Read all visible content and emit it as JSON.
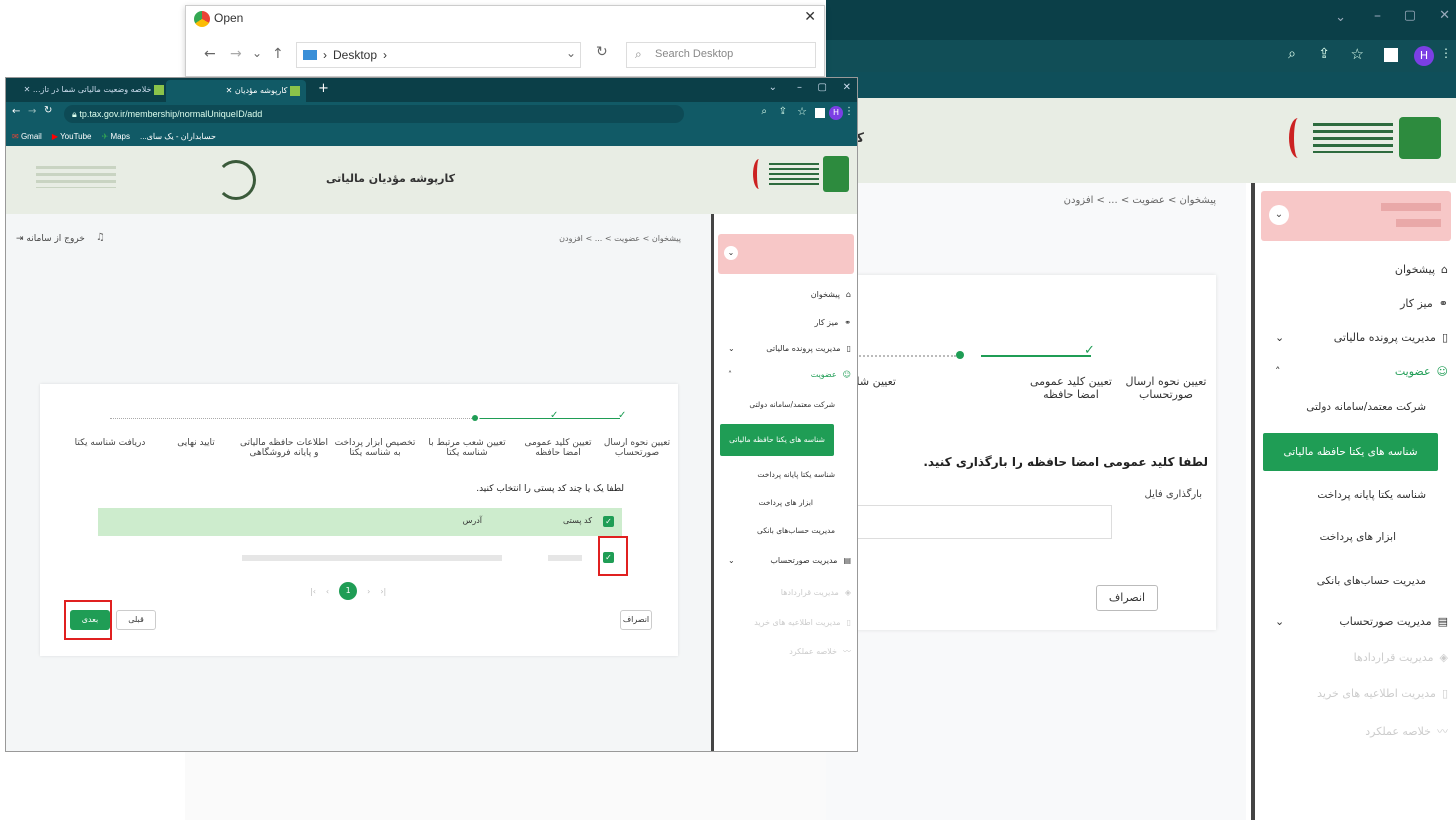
{
  "dialog": {
    "title": "Open",
    "path": "Desktop",
    "search_placeholder": "Search Desktop",
    "close": "✕"
  },
  "small_browser": {
    "tabs": [
      {
        "label": "خلاصه وضعیت مالیاتی شما در تاز..."
      },
      {
        "label": "کارپوشه مؤدیان"
      }
    ],
    "url": "tp.tax.gov.ir/membership/normalUniqueID/add",
    "bookmarks": [
      "Gmail",
      "YouTube",
      "Maps",
      "حسابداران - یک سای..."
    ],
    "header_title": "کارپوشه مؤدیان مالیاتی",
    "logout": "خروج از سامانه",
    "breadcrumb": "پیشخوان > عضویت > ... > افزودن",
    "steps": [
      "تعیین نحوه ارسال صورتحساب",
      "تعیین کلید عمومی امضا حافظه",
      "تعیین شعب مرتبط با شناسه یکتا",
      "تخصیص ابزار پرداخت به شناسه یکتا",
      "اطلاعات حافظه مالیاتی و پایانه فروشگاهی",
      "تایید نهایی",
      "دریافت شناسه یکتا"
    ],
    "instruction": "لطفا یک یا چند کد پستی را انتخاب کنید.",
    "table_headers": {
      "code": "کد پستی",
      "address": "آدرس"
    },
    "pagination": {
      "current": "1"
    },
    "buttons": {
      "next": "بعدی",
      "prev": "قبلی",
      "cancel": "انصراف"
    },
    "sidebar": {
      "items": [
        {
          "label": "پیشخوان"
        },
        {
          "label": "میز کار"
        },
        {
          "label": "مدیریت پرونده مالیاتی"
        },
        {
          "label": "عضویت"
        },
        {
          "label": "شرکت معتمد/سامانه دولتی"
        },
        {
          "label": "شناسه های یکتا حافظه مالیاتی"
        },
        {
          "label": "شناسه یکتا پایانه پرداخت"
        },
        {
          "label": "ابزار های پرداخت"
        },
        {
          "label": "مدیریت حساب‌های بانکی"
        },
        {
          "label": "مدیریت صورتحساب"
        },
        {
          "label": "مدیریت قراردادها"
        },
        {
          "label": "مدیریت اطلاعیه های خرید"
        },
        {
          "label": "خلاصه عملکرد"
        }
      ]
    }
  },
  "big_browser": {
    "breadcrumb": "پیشخوان > عضویت > ... > افزودن",
    "header_title_partial": "کار",
    "steps": [
      "تعیین نحوه ارسال صورتحساب",
      "تعیین کلید عمومی امضا حافظه",
      "تعیین شا"
    ],
    "instruction": "لطفا کلید عمومی امضا حافظه را بارگذاری کنید.",
    "upload_label": "بارگذاری فایل",
    "cancel": "انصراف",
    "sidebar": {
      "items": [
        {
          "label": "پیشخوان"
        },
        {
          "label": "میز کار"
        },
        {
          "label": "مدیریت پرونده مالیاتی"
        },
        {
          "label": "عضویت"
        },
        {
          "label": "شرکت معتمد/سامانه دولتی"
        },
        {
          "label": "شناسه های یکتا حافظه مالیاتی"
        },
        {
          "label": "شناسه یکتا پایانه پرداخت"
        },
        {
          "label": "ابزار های پرداخت"
        },
        {
          "label": "مدیریت حساب‌های بانکی"
        },
        {
          "label": "مدیریت صورتحساب"
        },
        {
          "label": "مدیریت قراردادها"
        },
        {
          "label": "مدیریت اطلاعیه های خرید"
        },
        {
          "label": "خلاصه عملکرد"
        }
      ]
    },
    "profile_initial": "H"
  },
  "colors": {
    "accent": "#1f9d55",
    "highlight_row": "#cdeccd",
    "header_dark": "#0f4f5a",
    "pink": "#f7c7c7",
    "red_box": "#e02020"
  }
}
